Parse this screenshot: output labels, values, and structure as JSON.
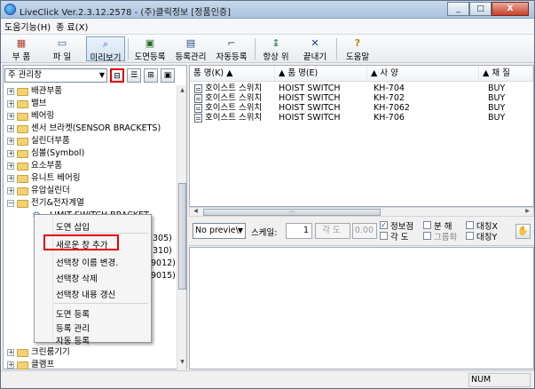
{
  "window": {
    "title": "LiveClick Ver.2.3.12.2578 - (주)클릭정보 [정품인증]",
    "controls": [
      "_",
      "□",
      "X"
    ]
  },
  "menubar": [
    "도움기능(H)",
    "종 료(X)"
  ],
  "toolbar": [
    {
      "label": "부 품",
      "icon": "parts-icon",
      "glyph": "▦"
    },
    {
      "label": "파 일",
      "icon": "folder-icon",
      "glyph": "▭"
    },
    {
      "label": "미리보기",
      "icon": "magnifier-icon",
      "glyph": "⌕"
    },
    {
      "label": "도면등록",
      "icon": "drawing-register-icon",
      "glyph": "▣"
    },
    {
      "label": "등록관리",
      "icon": "register-manage-icon",
      "glyph": "▤"
    },
    {
      "label": "자동등록",
      "icon": "auto-register-icon",
      "glyph": "⌐"
    },
    {
      "label": "항상 위",
      "icon": "pin-icon",
      "glyph": "↨"
    },
    {
      "label": "끝내기",
      "icon": "exit-icon",
      "glyph": "✕"
    },
    {
      "label": "도움말",
      "icon": "help-icon",
      "glyph": "?"
    }
  ],
  "left": {
    "combo": "주 관리창",
    "tree": [
      {
        "label": "배관부품",
        "expander": "+"
      },
      {
        "label": "밸브",
        "expander": "+"
      },
      {
        "label": "베어링",
        "expander": "+"
      },
      {
        "label": "센서 브라켓(SENSOR BRACKETS)",
        "expander": "+"
      },
      {
        "label": "실린더부품",
        "expander": "+"
      },
      {
        "label": "심볼(Symbol)",
        "expander": "+"
      },
      {
        "label": "요소부품",
        "expander": "+"
      },
      {
        "label": "유니트 베어링",
        "expander": "+"
      },
      {
        "label": "유압실린더",
        "expander": "+"
      },
      {
        "label": "전기&전자계열",
        "expander": "−"
      },
      {
        "label": "LIMIT SWITCH BRACKET",
        "child": true
      }
    ],
    "tree_bottom": [
      {
        "label": "크린룸기기",
        "expander": "+"
      },
      {
        "label": "클램프",
        "expander": "+"
      },
      {
        "label": "펌프",
        "expander": "+"
      }
    ],
    "partial_labels": [
      "305)",
      "310)",
      "9012)",
      "9015)"
    ]
  },
  "context_menu": {
    "items": [
      "도면 삽입",
      "새로운 창 추가",
      "선택창 이름 변경.",
      "선택창 삭제",
      "선택창 내용 갱신",
      "도면 등록",
      "등록 관리",
      "자동 등록"
    ],
    "highlighted_index": 1
  },
  "list": {
    "columns": [
      "품 명(K) ▲",
      "▲ 품 명(E)",
      "▲ 사 양",
      "▲ 채 질"
    ],
    "rows": [
      [
        "호이스트 스위치",
        "HOIST SWITCH",
        "KH-704",
        "BUY"
      ],
      [
        "호이스트 스위치",
        "HOIST SWITCH",
        "KH-702",
        "BUY"
      ],
      [
        "호이스트 스위치",
        "HOIST SWITCH",
        "KH-7062",
        "BUY"
      ],
      [
        "호이스트 스위치",
        "HOIST SWITCH",
        "KH-706",
        "BUY"
      ]
    ]
  },
  "options": {
    "preview": "No previe\\",
    "scale_label": "스케일:",
    "scale_value": "1",
    "angle_label": "각 도",
    "angle_value": "0.00",
    "checks": [
      {
        "label": "정보점",
        "checked": true
      },
      {
        "label": "각  도",
        "checked": false
      },
      {
        "label": "분  해",
        "checked": false
      },
      {
        "label": "그룹화",
        "checked": false,
        "grey": true
      },
      {
        "label": "대칭X",
        "checked": false
      },
      {
        "label": "대칭Y",
        "checked": false
      }
    ]
  },
  "status": {
    "num": "NUM"
  }
}
